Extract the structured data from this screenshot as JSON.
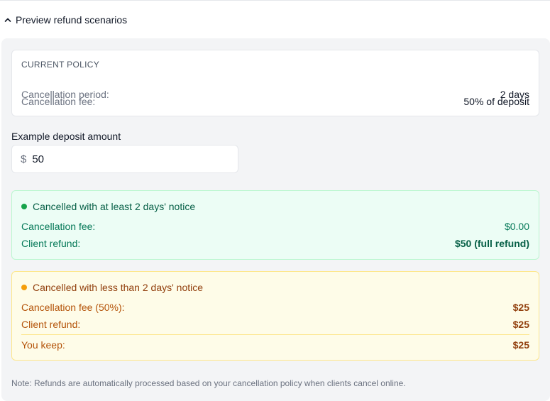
{
  "section": {
    "title": "Preview refund scenarios",
    "chevron_icon": "chevron-up-icon"
  },
  "policy": {
    "label": "CURRENT POLICY",
    "rows": [
      {
        "key": "Cancellation period:",
        "value": "2 days"
      },
      {
        "key": "Cancellation fee:",
        "value": "50% of deposit"
      }
    ]
  },
  "deposit": {
    "label": "Example deposit amount",
    "currency": "$",
    "value": "50"
  },
  "scenario_early": {
    "title": "Cancelled with at least 2 days' notice",
    "status_color": "#16a34a",
    "rows": [
      {
        "key": "Cancellation fee:",
        "value": "$0.00"
      },
      {
        "key": "Client refund:",
        "value": "$50 (full refund)"
      }
    ]
  },
  "scenario_late": {
    "title": "Cancelled with less than 2 days' notice",
    "status_color": "#f59e0b",
    "rows": [
      {
        "key": "Cancellation fee (50%):",
        "value": "$25"
      },
      {
        "key": "Client refund:",
        "value": "$25"
      },
      {
        "key": "You keep:",
        "value": "$25"
      }
    ]
  },
  "note": "Note: Refunds are automatically processed based on your cancellation policy when clients cancel online."
}
